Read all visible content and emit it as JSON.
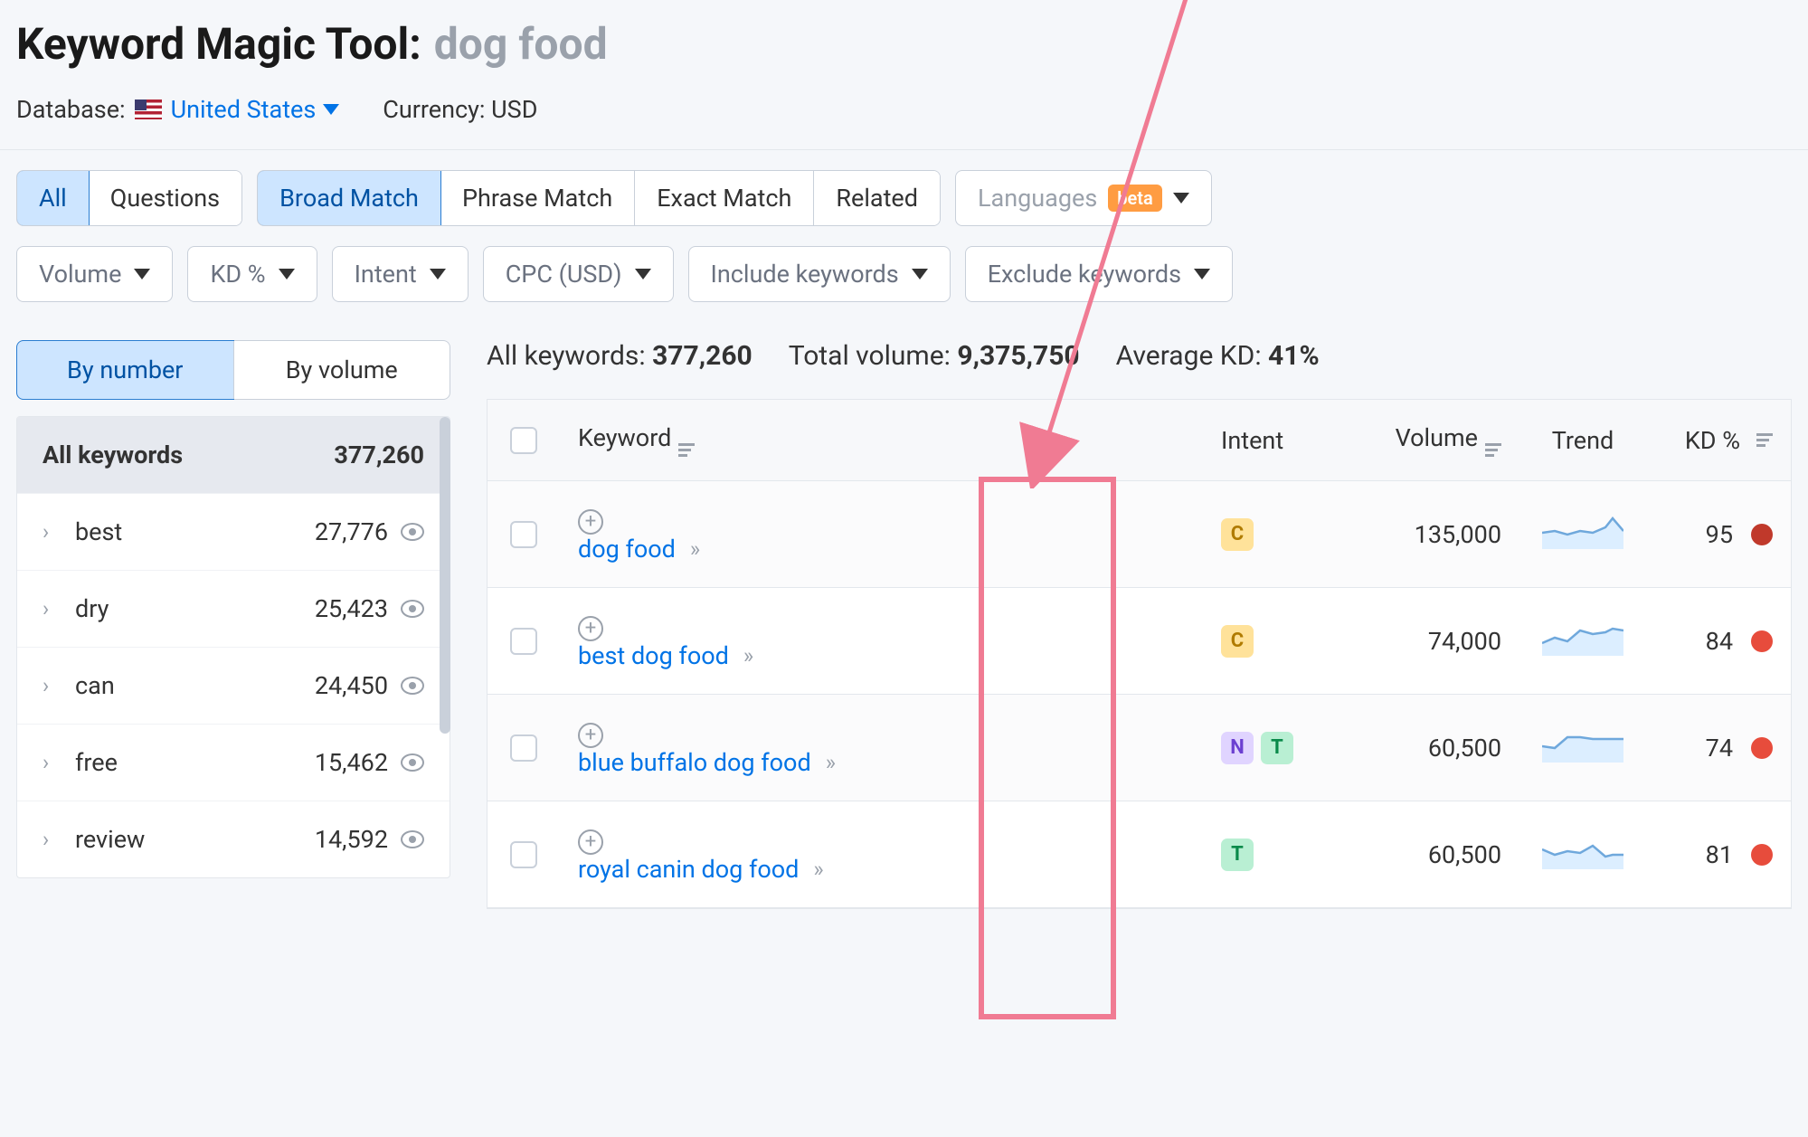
{
  "header": {
    "tool_name": "Keyword Magic Tool:",
    "query": "dog food",
    "database_label": "Database:",
    "country": "United States",
    "currency_label": "Currency: USD"
  },
  "toolbar": {
    "scope": {
      "all": "All",
      "questions": "Questions"
    },
    "match": {
      "broad": "Broad Match",
      "phrase": "Phrase Match",
      "exact": "Exact Match",
      "related": "Related"
    },
    "languages": "Languages",
    "beta": "beta",
    "filters": {
      "volume": "Volume",
      "kd": "KD %",
      "intent": "Intent",
      "cpc": "CPC (USD)",
      "include": "Include keywords",
      "exclude": "Exclude keywords"
    }
  },
  "sidebar": {
    "view": {
      "by_number": "By number",
      "by_volume": "By volume"
    },
    "all_label": "All keywords",
    "all_count": "377,260",
    "groups": [
      {
        "name": "best",
        "count": "27,776"
      },
      {
        "name": "dry",
        "count": "25,423"
      },
      {
        "name": "can",
        "count": "24,450"
      },
      {
        "name": "free",
        "count": "15,462"
      },
      {
        "name": "review",
        "count": "14,592"
      }
    ]
  },
  "stats": {
    "all_kw_label": "All keywords:",
    "all_kw_val": "377,260",
    "tot_vol_label": "Total volume:",
    "tot_vol_val": "9,375,750",
    "avg_kd_label": "Average KD:",
    "avg_kd_val": "41%"
  },
  "columns": {
    "keyword": "Keyword",
    "intent": "Intent",
    "volume": "Volume",
    "trend": "Trend",
    "kd": "KD %"
  },
  "rows": [
    {
      "keyword": "dog food",
      "intents": [
        "C"
      ],
      "volume": "135,000",
      "kd": "95",
      "kd_class": "vhigh",
      "spark": "0,22 14,20 28,24 42,20 56,22 70,16 78,6 90,20"
    },
    {
      "keyword": "best dog food",
      "intents": [
        "C"
      ],
      "volume": "74,000",
      "kd": "84",
      "kd_class": "hard",
      "spark": "0,26 14,20 28,24 42,12 56,16 70,14 78,10 90,12"
    },
    {
      "keyword": "blue buffalo dog food",
      "intents": [
        "N",
        "T"
      ],
      "volume": "60,500",
      "kd": "74",
      "kd_class": "hard",
      "spark": "0,22 14,24 28,12 42,12 56,14 70,14 78,14 90,14"
    },
    {
      "keyword": "royal canin dog food",
      "intents": [
        "T"
      ],
      "volume": "60,500",
      "kd": "81",
      "kd_class": "hard",
      "spark": "0,18 14,24 28,20 42,22 56,14 70,26 78,24 90,24"
    }
  ]
}
